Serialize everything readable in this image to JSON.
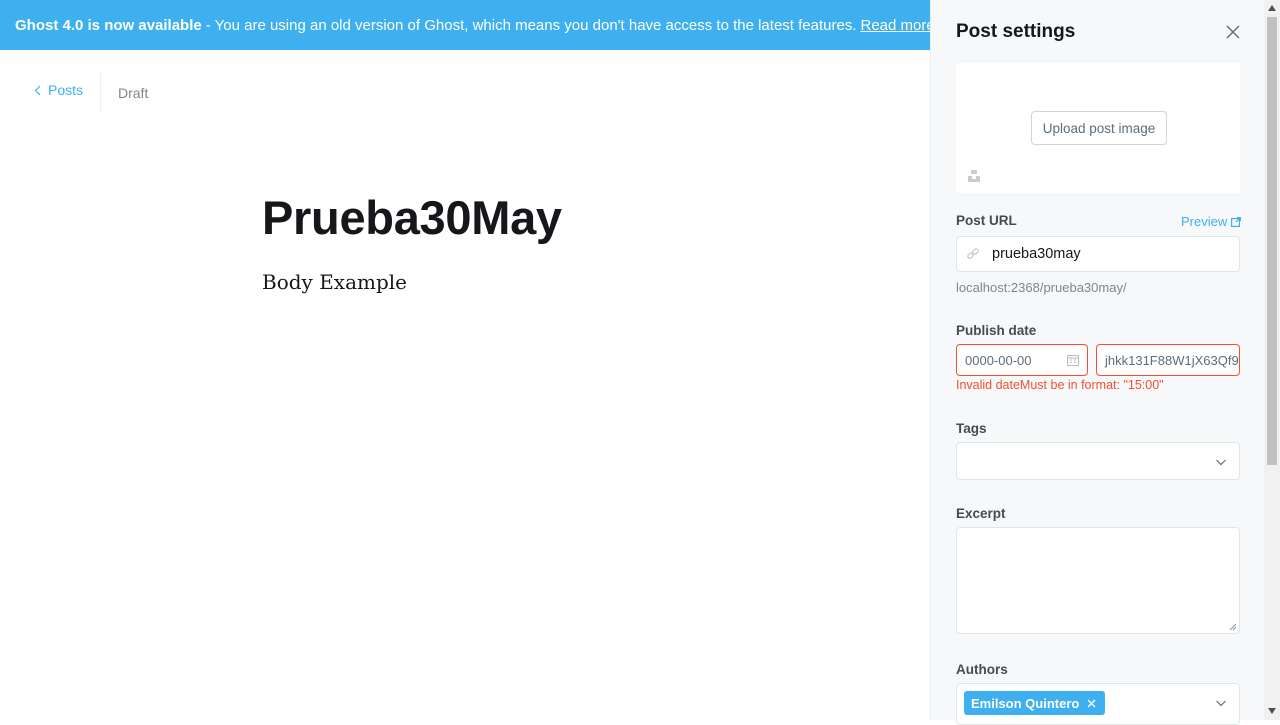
{
  "banner": {
    "strong": "Ghost 4.0 is now available",
    "message": "- You are using an old version of Ghost, which means you don't have access to the latest features.",
    "link": "Read more!"
  },
  "nav": {
    "back_label": "Posts",
    "status": "Draft"
  },
  "post": {
    "title": "Prueba30May",
    "body": "Body Example"
  },
  "settings": {
    "title": "Post settings",
    "upload_label": "Upload post image",
    "post_url_label": "Post URL",
    "preview_label": "Preview",
    "url_value": "prueba30may",
    "url_hint": "localhost:2368/prueba30may/",
    "publish_date_label": "Publish date",
    "date_value": "0000-00-00",
    "time_value": "jhkk131F88W1jX63Qf9",
    "error": "Invalid dateMust be in format: \"15:00\"",
    "tags_label": "Tags",
    "excerpt_label": "Excerpt",
    "authors_label": "Authors",
    "author_tag": "Emilson Quintero"
  },
  "colors": {
    "accent": "#3eb0ef",
    "error": "#f05230",
    "panel_bg": "#f6f8fa"
  }
}
